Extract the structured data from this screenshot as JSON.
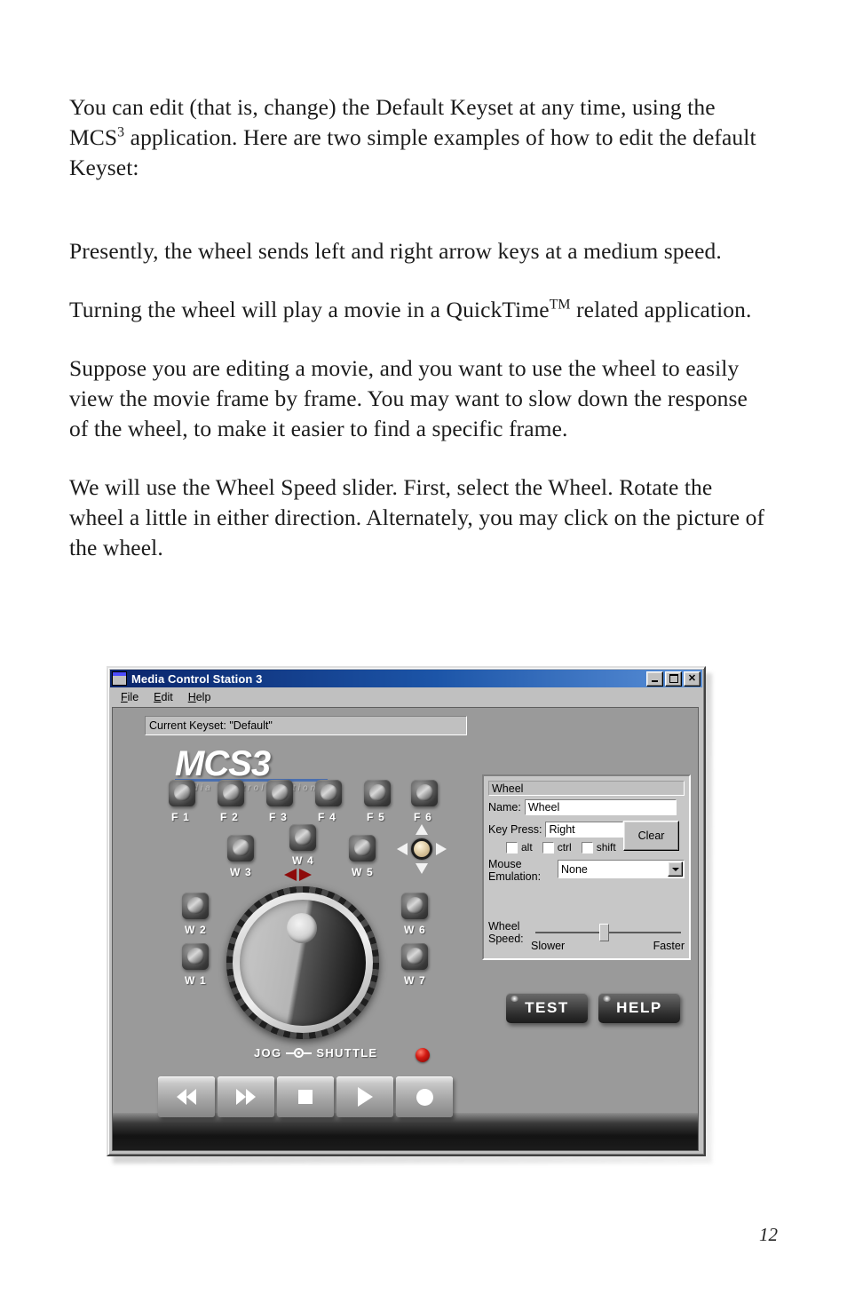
{
  "document": {
    "paragraphs": [
      "You can edit (that is, change) the Default Keyset at any time, using the MCS|SUP3|SUP application. Here are two simple examples of how to edit the default Keyset:",
      "Presently, the wheel sends left and right arrow keys at a medium speed.",
      "Turning the wheel will play a movie in a QuickTime|TM| related application.",
      "Suppose you are editing a movie, and you want to use the wheel to easily view the movie frame by frame. You may want to slow down the response of the wheel, to make it easier to find a specific frame.",
      "We will use the Wheel Speed slider. First, select the Wheel. Rotate the wheel a little in either direction. Alternately, you may click on the picture of the wheel."
    ],
    "para1_a": "You can edit (that is, change) the Default Keyset at any time, using the MCS",
    "para1_sup": "3",
    "para1_b": " application. Here are two simple examples of how to edit the default Keyset:",
    "para2": "Presently, the wheel sends left and right arrow keys at a medium speed.",
    "para3_a": "Turning the wheel will play a movie in a QuickTime",
    "para3_tm": "TM",
    "para3_b": " related application.",
    "para4": "Suppose you are editing a movie, and you want to use the wheel to easily view the movie frame by frame. You may want to slow down the response of the wheel, to make it easier to find a specific frame.",
    "para5": "We will use the Wheel Speed slider. First, select the Wheel. Rotate the wheel a little in either direction. Alternately, you may click on the picture of the wheel.",
    "page_number": "12"
  },
  "app": {
    "title": "Media Control Station 3",
    "titlebar_buttons": {
      "minimize": "_",
      "maximize": "□",
      "close": "✕"
    },
    "menu": [
      {
        "accel": "F",
        "rest": "ile"
      },
      {
        "accel": "E",
        "rest": "dit"
      },
      {
        "accel": "H",
        "rest": "elp"
      }
    ],
    "keyset_status": "Current Keyset: \"Default\"",
    "logo": {
      "main": "MCS3",
      "sub": "Media Control Station"
    },
    "function_keys": [
      "F 1",
      "F 2",
      "F 3",
      "F 4",
      "F 5",
      "F 6"
    ],
    "wheel_keys": [
      "W 1",
      "W 2",
      "W 3",
      "W 4",
      "W 5",
      "W 6",
      "W 7"
    ],
    "jog_shuttle": {
      "left_label": "JOG",
      "right_label": "SHUTTLE"
    },
    "transport": [
      "rewind",
      "fast-forward",
      "stop",
      "play",
      "record"
    ],
    "panel": {
      "header": "Wheel",
      "name_label": "Name:",
      "name_value": "Wheel",
      "key_press_label": "Key Press:",
      "key_press_value": "Right",
      "clear_label": "Clear",
      "modifiers": [
        {
          "label": "alt",
          "checked": false
        },
        {
          "label": "ctrl",
          "checked": false
        },
        {
          "label": "shift",
          "checked": false
        }
      ],
      "mouse_label_line1": "Mouse",
      "mouse_label_line2": "Emulation:",
      "mouse_value": "None",
      "mouse_options": [
        "None"
      ],
      "wheel_speed_label_line1": "Wheel",
      "wheel_speed_label_line2": "Speed:",
      "slider_min_label": "Slower",
      "slider_max_label": "Faster",
      "slider_value_pct": 45
    },
    "buttons": {
      "test": "TEST",
      "help": "HELP"
    },
    "colors": {
      "titlebar_start": "#0a246a",
      "titlebar_end": "#5a90d8",
      "window_face": "#c0c0c0",
      "device_face": "#9a9a9a",
      "logo_rule": "#4a6fb0",
      "led_red": "#d21a12",
      "w4_arrow_red": "#8e0b0b",
      "dpad_center": "#e4d2ac"
    }
  }
}
